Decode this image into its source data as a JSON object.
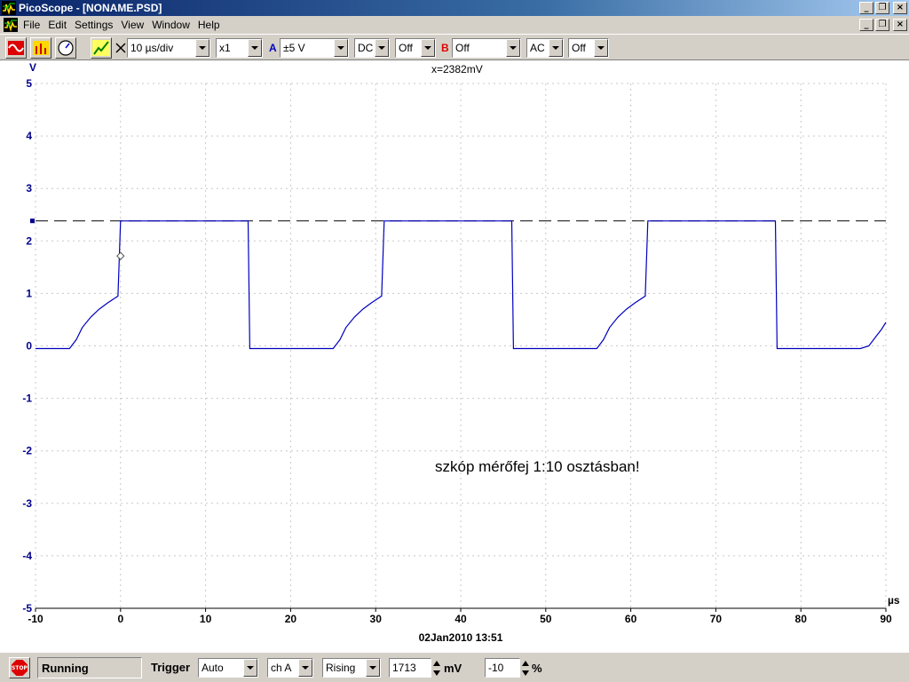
{
  "window": {
    "title": "PicoScope - [NONAME.PSD]"
  },
  "menu": [
    "File",
    "Edit",
    "Settings",
    "View",
    "Window",
    "Help"
  ],
  "toolbar": {
    "timebase": "10 µs/div",
    "multiplier": "x1",
    "channel_a": {
      "label": "A",
      "range": "±5 V",
      "coupling": "DC",
      "option": "Off",
      "color": "#0000c0"
    },
    "channel_b": {
      "label": "B",
      "range": "Off",
      "coupling": "AC",
      "option": "Off",
      "color": "#e00000"
    }
  },
  "plot": {
    "y_unit": "V",
    "x_unit": "µs",
    "cursor_readout": "x=2382mV",
    "annotation": "szkóp mérőfej 1:10 osztásban!",
    "date_label": "02Jan2010  13:51",
    "trace_color": "#0000c0",
    "axis_label_color": "#00008b",
    "cursor_level_v": 2.382,
    "trigger_point": {
      "t_us": 0,
      "v": 1.713
    }
  },
  "chart_data": {
    "type": "line",
    "xlabel": "µs",
    "ylabel": "V",
    "xlim": [
      -10,
      90
    ],
    "ylim": [
      -5,
      5
    ],
    "x_ticks": [
      -10,
      0,
      10,
      20,
      30,
      40,
      50,
      60,
      70,
      80,
      90
    ],
    "y_ticks": [
      5,
      4,
      3,
      2,
      1,
      0,
      -1,
      -2,
      -3,
      -4,
      -5
    ],
    "grid": true,
    "series": [
      {
        "x": [
          -10,
          -6,
          -5.2,
          -4.5,
          -3.5,
          -2.5,
          -1.5,
          -0.3,
          0,
          15,
          15.2,
          25,
          25.8,
          26.5,
          27.5,
          28.5,
          29.5,
          30.7,
          31,
          46,
          46.2,
          56,
          56.8,
          57.5,
          58.5,
          59.5,
          60.5,
          61.7,
          62,
          77,
          77.2,
          87,
          88,
          88.7,
          89.5,
          90
        ],
        "y": [
          -0.05,
          -0.05,
          0.12,
          0.35,
          0.55,
          0.7,
          0.82,
          0.95,
          2.38,
          2.38,
          -0.05,
          -0.05,
          0.12,
          0.35,
          0.55,
          0.7,
          0.82,
          0.95,
          2.38,
          2.38,
          -0.05,
          -0.05,
          0.12,
          0.35,
          0.55,
          0.7,
          0.82,
          0.95,
          2.38,
          2.38,
          -0.05,
          -0.05,
          0.0,
          0.15,
          0.32,
          0.45
        ]
      }
    ]
  },
  "status": {
    "state": "Running",
    "trigger_label": "Trigger",
    "trigger_mode": "Auto",
    "trigger_channel": "ch A",
    "trigger_edge": "Rising",
    "trigger_level": "1713",
    "trigger_level_unit": "mV",
    "pretrigger": "-10",
    "pretrigger_unit": "%"
  }
}
